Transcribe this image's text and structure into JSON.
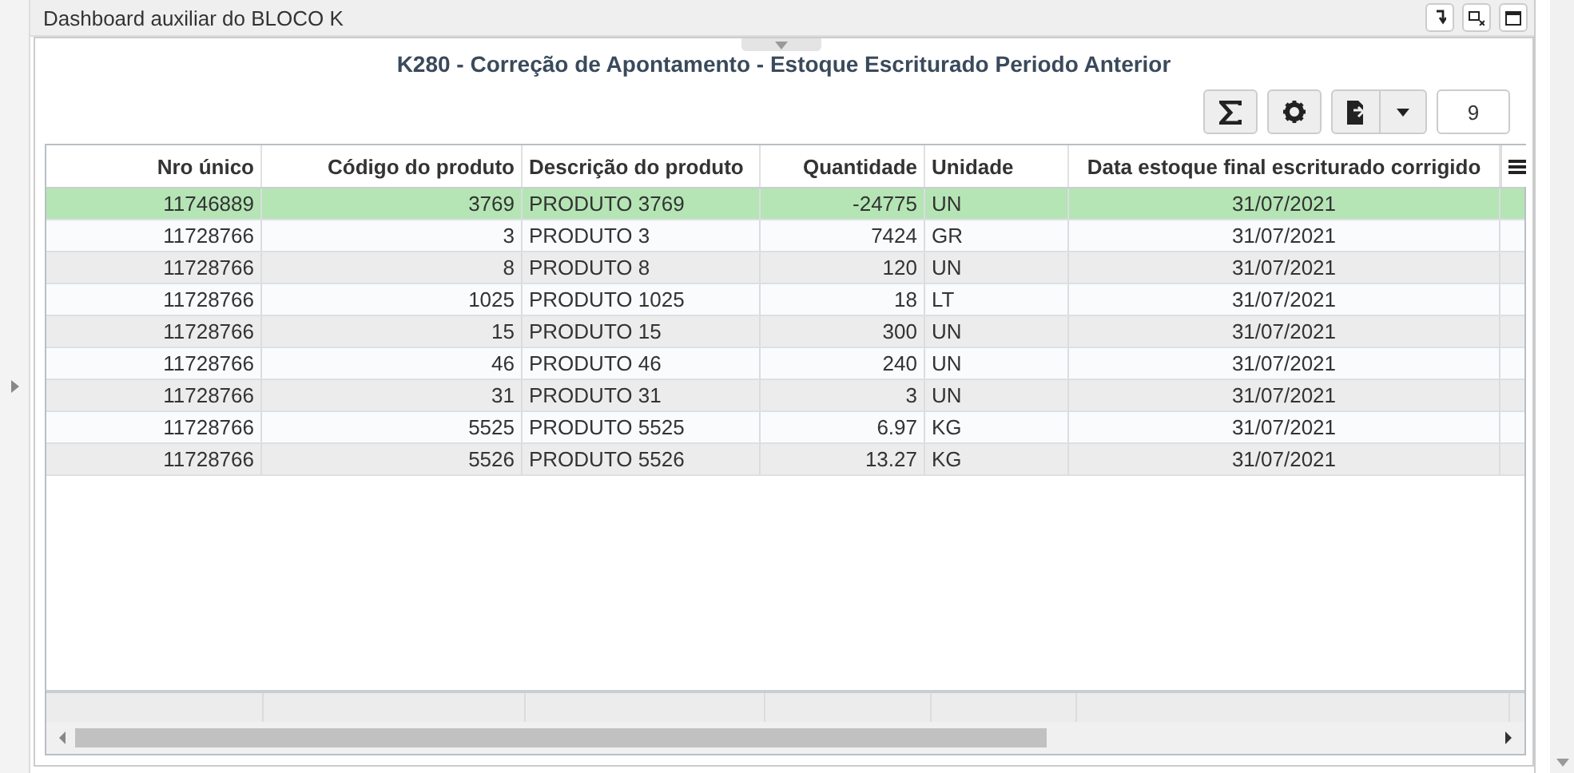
{
  "panel": {
    "title": "Dashboard auxiliar do BLOCO K"
  },
  "report": {
    "title": "K280 - Correção de Apontamento - Estoque Escriturado Periodo Anterior",
    "page_size": "9"
  },
  "table": {
    "columns": [
      {
        "label": "Nro único"
      },
      {
        "label": "Código do produto"
      },
      {
        "label": "Descrição do produto"
      },
      {
        "label": "Quantidade"
      },
      {
        "label": "Unidade"
      },
      {
        "label": "Data estoque final escriturado corrigido"
      }
    ],
    "rows": [
      {
        "cells": [
          "11746889",
          "3769",
          "PRODUTO 3769",
          "-24775",
          "UN",
          "31/07/2021"
        ],
        "selected": true
      },
      {
        "cells": [
          "11728766",
          "3",
          "PRODUTO 3",
          "7424",
          "GR",
          "31/07/2021"
        ],
        "selected": false
      },
      {
        "cells": [
          "11728766",
          "8",
          "PRODUTO 8",
          "120",
          "UN",
          "31/07/2021"
        ],
        "selected": false
      },
      {
        "cells": [
          "11728766",
          "1025",
          "PRODUTO 1025",
          "18",
          "LT",
          "31/07/2021"
        ],
        "selected": false
      },
      {
        "cells": [
          "11728766",
          "15",
          "PRODUTO 15",
          "300",
          "UN",
          "31/07/2021"
        ],
        "selected": false
      },
      {
        "cells": [
          "11728766",
          "46",
          "PRODUTO 46",
          "240",
          "UN",
          "31/07/2021"
        ],
        "selected": false
      },
      {
        "cells": [
          "11728766",
          "31",
          "PRODUTO 31",
          "3",
          "UN",
          "31/07/2021"
        ],
        "selected": false
      },
      {
        "cells": [
          "11728766",
          "5525",
          "PRODUTO 5525",
          "6.97",
          "KG",
          "31/07/2021"
        ],
        "selected": false
      },
      {
        "cells": [
          "11728766",
          "5526",
          "PRODUTO 5526",
          "13.27",
          "KG",
          "31/07/2021"
        ],
        "selected": false
      }
    ]
  }
}
